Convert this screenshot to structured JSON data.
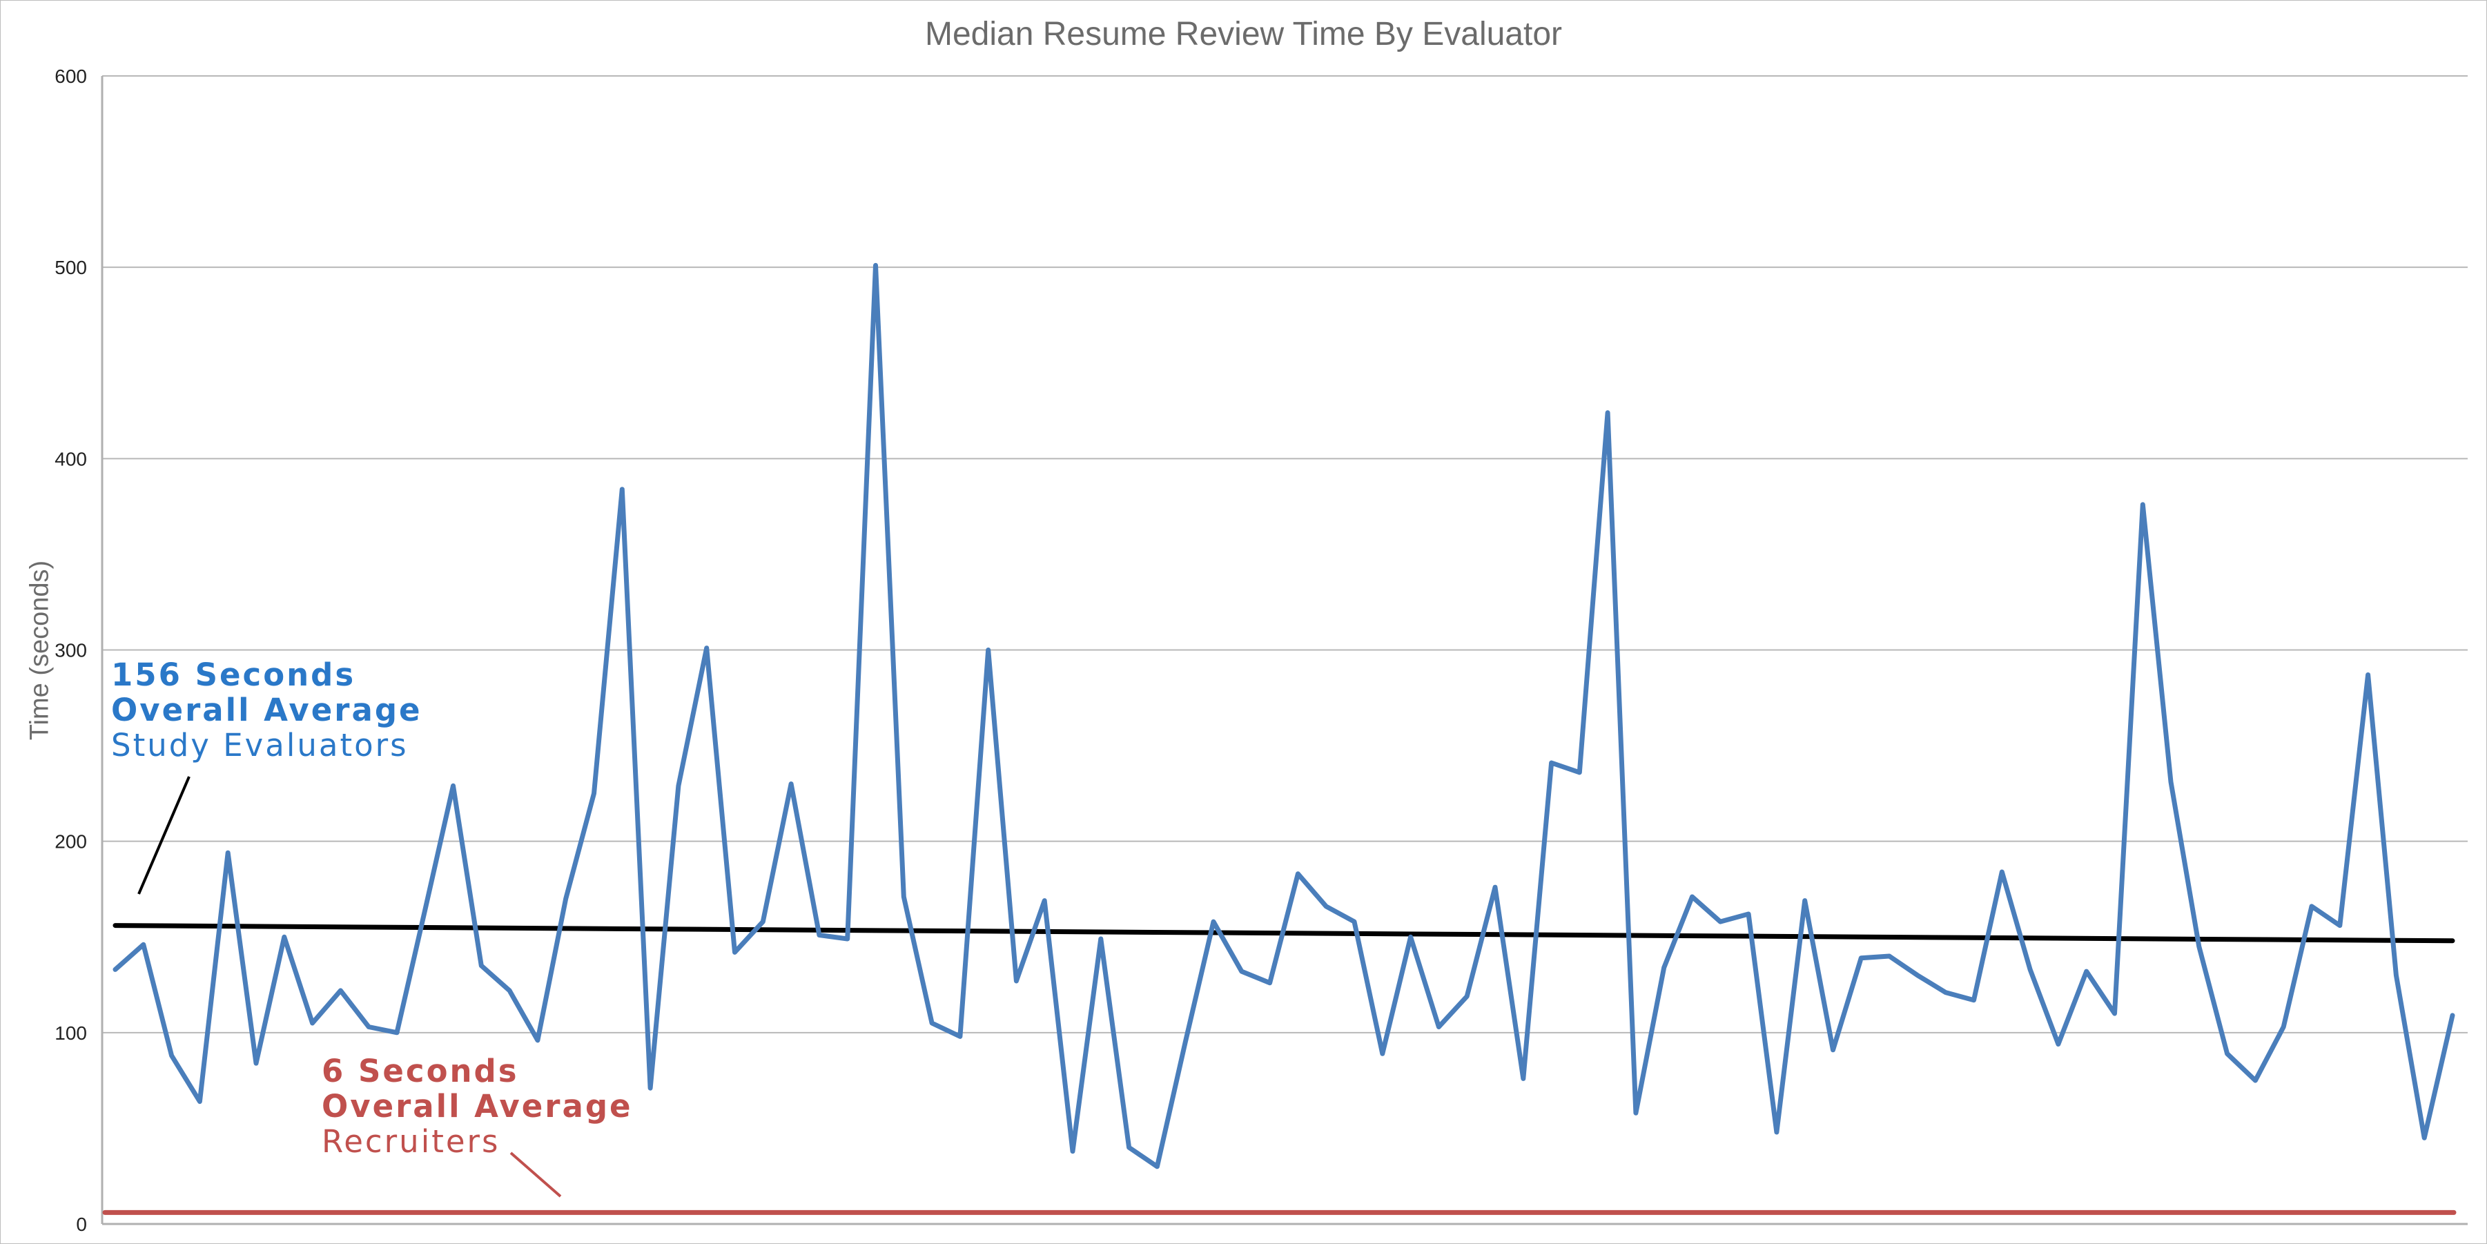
{
  "chart_data": {
    "type": "line",
    "title": "Median Resume Review Time By Evaluator",
    "xlabel": "",
    "ylabel": "Time (seconds)",
    "ylim": [
      0,
      600
    ],
    "yticks": [
      0,
      100,
      200,
      300,
      400,
      500,
      600
    ],
    "grid": true,
    "colors": {
      "evaluators": "#4a7ebb",
      "recruiters": "#c0504d",
      "trend": "#000000"
    },
    "series": [
      {
        "values": [
          133,
          146,
          88,
          64,
          194,
          84,
          150,
          105,
          122,
          103,
          100,
          164,
          229,
          135,
          122,
          96,
          170,
          225,
          384,
          71,
          229,
          301,
          142,
          158,
          230,
          151,
          149,
          501,
          171,
          105,
          98,
          300,
          127,
          169,
          38,
          149,
          40,
          30,
          95,
          158,
          132,
          126,
          183,
          166,
          158,
          89,
          150,
          103,
          119,
          176,
          76,
          241,
          236,
          424,
          58,
          134,
          171,
          158,
          162,
          48,
          169,
          91,
          139,
          140,
          130,
          121,
          117,
          184,
          133,
          94,
          132,
          110,
          376,
          231,
          145,
          89,
          75,
          103,
          166,
          156,
          287,
          130,
          45,
          109
        ]
      },
      {
        "values": [
          156,
          148
        ]
      },
      {
        "values": [
          6,
          6
        ]
      }
    ],
    "annotations": {
      "evaluators": {
        "line1": "156 Seconds",
        "line2": "Overall Average",
        "line3": "Study Evaluators"
      },
      "recruiters": {
        "line1": "6 Seconds",
        "line2": "Overall Average",
        "line3": "Recruiters"
      }
    }
  }
}
